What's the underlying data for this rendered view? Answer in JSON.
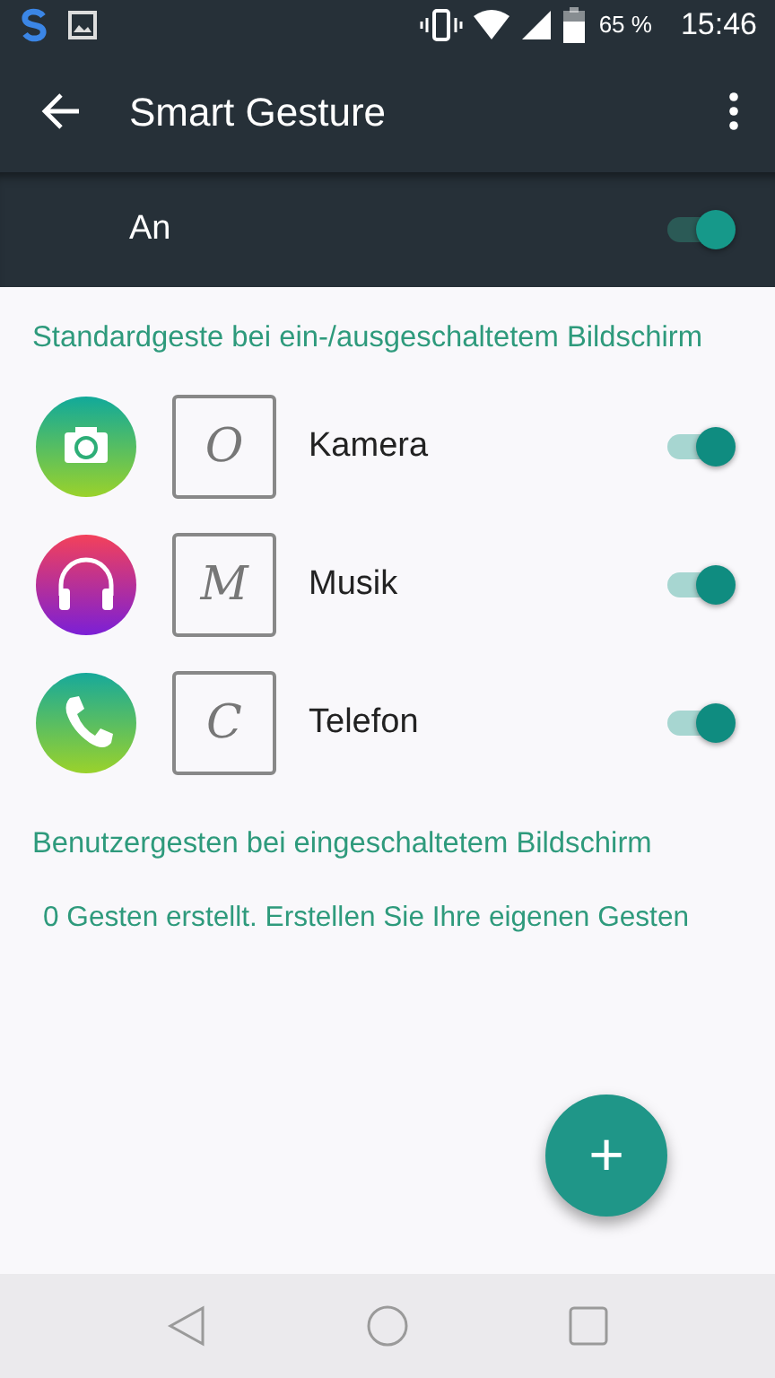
{
  "status_bar": {
    "battery": "65 %",
    "time": "15:46"
  },
  "app_bar": {
    "title": "Smart Gesture"
  },
  "master_switch": {
    "label": "An",
    "on": true
  },
  "sections": [
    {
      "title": "Standardgeste bei ein-/ausgeschaltetem Bildschirm",
      "gestures": [
        {
          "kind": "camera",
          "letter": "O",
          "label": "Kamera",
          "on": true
        },
        {
          "kind": "music",
          "letter": "M",
          "label": "Musik",
          "on": true
        },
        {
          "kind": "phone",
          "letter": "C",
          "label": "Telefon",
          "on": true
        }
      ]
    },
    {
      "title": "Benutzergesten bei eingeschaltetem Bildschirm",
      "empty_text": "0 Gesten erstellt. Erstellen Sie Ihre eigenen Gesten"
    }
  ],
  "fab": {
    "label": "+"
  }
}
